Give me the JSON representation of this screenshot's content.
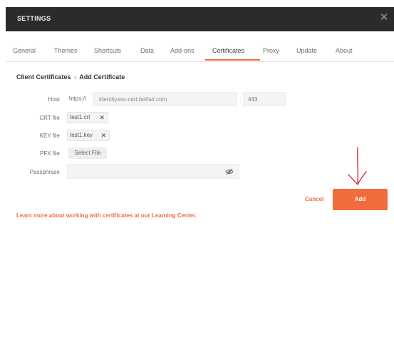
{
  "window": {
    "title": "SETTINGS",
    "close_glyph": "✕"
  },
  "tabs": [
    {
      "label": "General"
    },
    {
      "label": "Themes"
    },
    {
      "label": "Shortcuts"
    },
    {
      "label": "Data"
    },
    {
      "label": "Add-ons"
    },
    {
      "label": "Certificates",
      "active": true
    },
    {
      "label": "Proxy"
    },
    {
      "label": "Update"
    },
    {
      "label": "About"
    }
  ],
  "breadcrumb": {
    "parent": "Client Certificates",
    "separator": "›",
    "current": "Add Certificate"
  },
  "form": {
    "host": {
      "label": "Host",
      "prefix": "https://",
      "value": "identitysso-cert.betfair.com",
      "port_separator": ":",
      "port_placeholder": "443"
    },
    "crt": {
      "label": "CRT file",
      "value": "test1.crt"
    },
    "key": {
      "label": "KEY file",
      "value": "test1.key"
    },
    "pfx": {
      "label": "PFX file",
      "button": "Select File"
    },
    "passphrase": {
      "label": "Passphrase",
      "value": ""
    }
  },
  "actions": {
    "cancel": "Cancel",
    "add": "Add"
  },
  "learn_more": "Learn more about working with certificates at our Learning Center.",
  "icons": {
    "remove": "close-icon",
    "visibility": "eye-off-icon",
    "annotation": "hand-drawn-arrow-icon"
  },
  "colors": {
    "accent": "#f26b3a",
    "titlebar": "#2b2b2b",
    "annotation": "#d9343f"
  }
}
